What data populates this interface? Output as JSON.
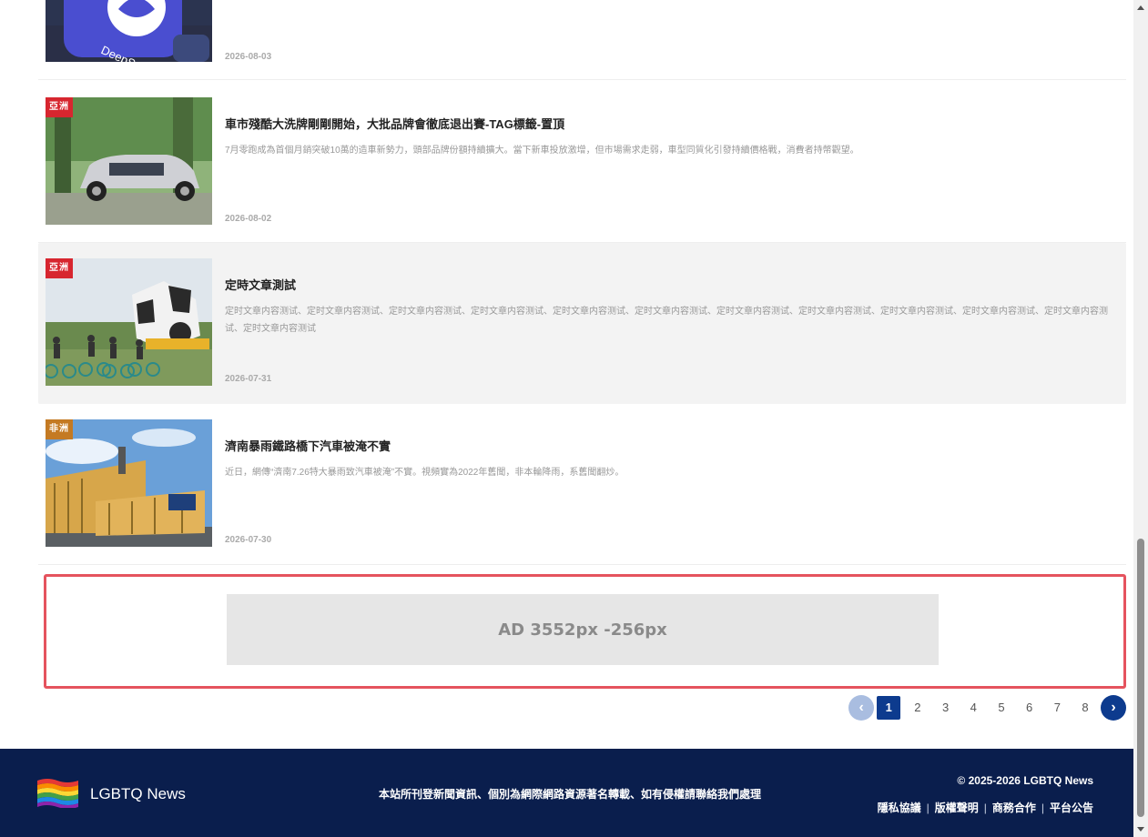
{
  "articles": [
    {
      "title": "",
      "summary": "",
      "date": "2026-08-03",
      "badge": "",
      "image": "deepseek-app-icon-photo",
      "thumb_text": "DeepSeek"
    },
    {
      "title": "車市殘酷大洗牌剛剛開始，大批品牌會徹底退出賽-TAG標籤-置頂",
      "summary": "7月零跑成為首個月銷突破10萬的造車新勢力，頭部品牌份額持續擴大。當下新車投放激增，但市場需求走弱，車型同質化引發持續價格戰，消費者持幣觀望。",
      "date": "2026-08-02",
      "badge": "亞洲",
      "badge_color": "#d7262f",
      "image": "silver-suv-photo"
    },
    {
      "title": "定時文章測試",
      "summary": "定时文章内容测试、定时文章内容测试、定时文章内容测试、定时文章内容测试、定时文章内容测试、定时文章内容测试、定时文章内容测试、定时文章内容测试、定时文章内容测试、定时文章内容测试、定时文章内容测试、定时文章内容测试",
      "date": "2026-07-31",
      "badge": "亞洲",
      "badge_color": "#d7262f",
      "image": "panda-sculpture-cyclists-photo",
      "highlighted": true
    },
    {
      "title": "濟南暴雨鐵路橋下汽車被淹不實",
      "summary": "近日，網傳“濟南7.26特大暴雨致汽車被淹”不實。視頻實為2022年舊聞，非本輪降雨，系舊聞翻炒。",
      "date": "2026-07-30",
      "badge": "非洲",
      "badge_color": "#c47a23",
      "image": "yellow-building-photo"
    }
  ],
  "ad": {
    "label": "AD  3552px -256px"
  },
  "pagination": {
    "prev": "‹",
    "next": "›",
    "pages": [
      "1",
      "2",
      "3",
      "4",
      "5",
      "6",
      "7",
      "8"
    ],
    "current": "1"
  },
  "footer": {
    "brand": "LGBTQ News",
    "logo_icon": "rainbow-flag-icon",
    "notice": "本站所刊登新聞資訊、個別為網際網路資源著名轉載、如有侵權請聯絡我們處理",
    "copyright": "© 2025-2026 LGBTQ News",
    "links": [
      "隱私協議",
      "版權聲明",
      "商務合作",
      "平台公告"
    ]
  },
  "colors": {
    "accent": "#0d3b8e",
    "footer_bg": "#0a1e4d",
    "ad_border": "#e5535e"
  }
}
